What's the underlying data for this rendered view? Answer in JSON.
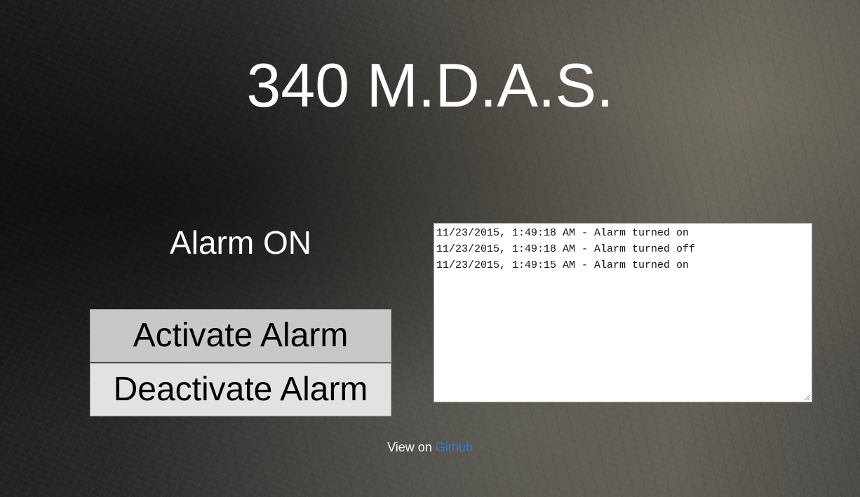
{
  "header": {
    "title": "340 M.D.A.S."
  },
  "alarm": {
    "status_text": "Alarm ON"
  },
  "buttons": {
    "activate_label": "Activate Alarm",
    "deactivate_label": "Deactivate Alarm"
  },
  "log": {
    "lines": [
      "11/23/2015, 1:49:18 AM - Alarm turned on",
      "11/23/2015, 1:49:18 AM - Alarm turned off",
      "11/23/2015, 1:49:15 AM - Alarm turned on"
    ]
  },
  "footer": {
    "prefix": "View on ",
    "link_label": "Github"
  },
  "colors": {
    "link": "#3a78c6",
    "activate_button_bg": "#c8c8c8",
    "deactivate_button_bg": "#e2e2e2"
  }
}
